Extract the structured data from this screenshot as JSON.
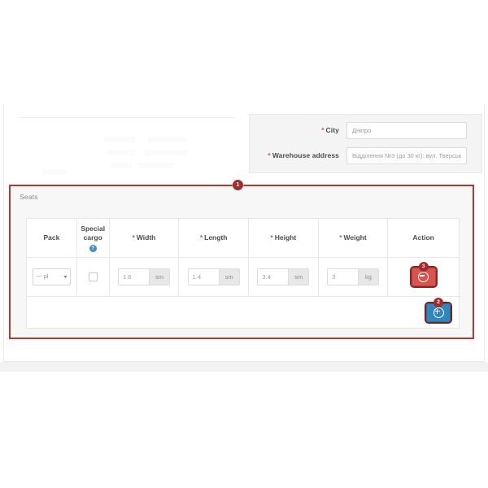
{
  "shipping_form": {
    "fields": [
      {
        "id": "city",
        "label": "City",
        "required_mark": "*",
        "value": "Дніпро"
      },
      {
        "id": "warehouse_address",
        "label": "Warehouse address",
        "required_mark": "*",
        "value": "Відділення №3 (до 30 кг): вул. Тверськ"
      }
    ]
  },
  "seats_panel": {
    "title": "Seats",
    "marker_label": "1",
    "table": {
      "headers": [
        {
          "label": "Pack",
          "required_mark": ""
        },
        {
          "label": "Special cargo",
          "required_mark": "",
          "icon": "info-icon",
          "icon_glyph": "?"
        },
        {
          "label": "Width",
          "required_mark": "*"
        },
        {
          "label": "Length",
          "required_mark": "*"
        },
        {
          "label": "Height",
          "required_mark": "*"
        },
        {
          "label": "Weight",
          "required_mark": "*"
        },
        {
          "label": "Action",
          "required_mark": ""
        }
      ],
      "rows": [
        {
          "pack": {
            "selected": "--- pl",
            "caret": "▾"
          },
          "special_cargo_checked": false,
          "width": {
            "value": "1.6",
            "unit": "sm"
          },
          "length": {
            "value": "1.4",
            "unit": "sm"
          },
          "height": {
            "value": "3.4",
            "unit": "sm"
          },
          "weight": {
            "value": "3",
            "unit": "kg"
          },
          "action": {
            "icon": "minus-icon",
            "badge": "3",
            "color": "#d9534f"
          }
        }
      ],
      "footer": {
        "action": {
          "icon": "plus-icon",
          "badge": "2",
          "color": "#2f87bd"
        }
      }
    }
  },
  "colors": {
    "accent_red": "#b03a38",
    "badge_red": "#a32b2b",
    "required_star": "#d9534f",
    "remove_button": "#d9534f",
    "add_button": "#2f87bd",
    "info_icon": "#3a8fc4",
    "panel_bg": "#f7f7f7",
    "page_bg": "#ffffff"
  }
}
